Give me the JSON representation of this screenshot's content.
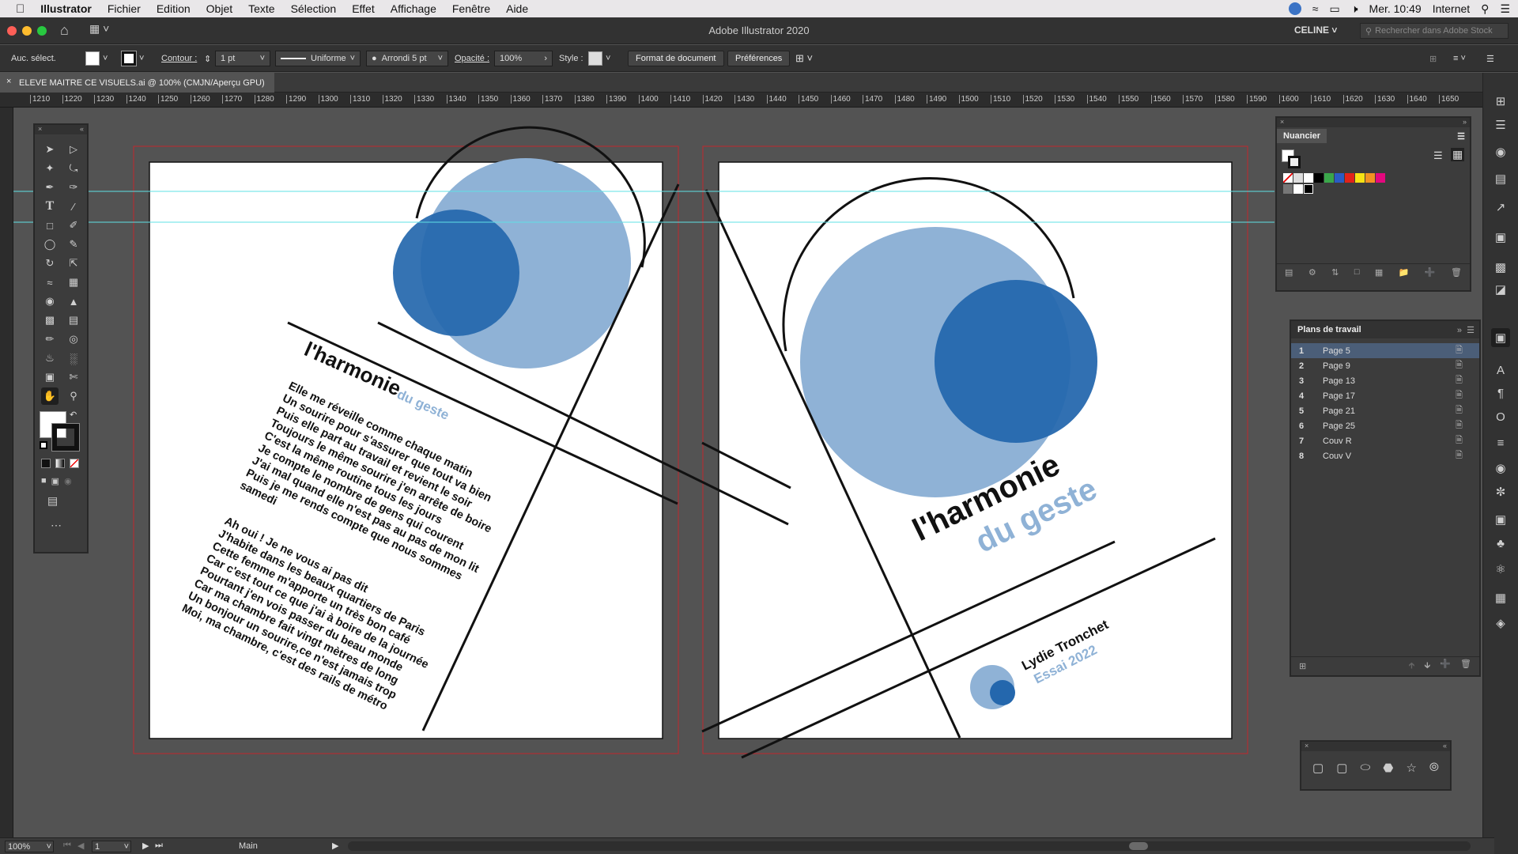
{
  "menubar": {
    "app": "Illustrator",
    "items": [
      "Fichier",
      "Edition",
      "Objet",
      "Texte",
      "Sélection",
      "Effet",
      "Affichage",
      "Fenêtre",
      "Aide"
    ],
    "clock": "Mer. 10:49",
    "network": "Internet"
  },
  "window": {
    "title": "Adobe Illustrator 2020",
    "user": "CELINE",
    "stock_search_placeholder": "Rechercher dans Adobe Stock"
  },
  "control": {
    "selection": "Auc. sélect.",
    "contour_label": "Contour :",
    "contour_value": "1 pt",
    "stroke_profile": "Uniforme",
    "brush": "Arrondi 5 pt",
    "opacity_label": "Opacité :",
    "opacity_value": "100%",
    "style_label": "Style :",
    "doc_format_button": "Format de document",
    "prefs_button": "Préférences"
  },
  "document_tab": "ELEVE MAITRE CE VISUELS.ai @ 100% (CMJN/Aperçu GPU)",
  "ruler_ticks": [
    "1210",
    "1220",
    "1230",
    "1240",
    "1250",
    "1260",
    "1270",
    "1280",
    "1290",
    "1300",
    "1310",
    "1320",
    "1330",
    "1340",
    "1350",
    "1360",
    "1370",
    "1380",
    "1390",
    "1400",
    "1410",
    "1420",
    "1430",
    "1440",
    "1450",
    "1460",
    "1470",
    "1480",
    "1490",
    "1500",
    "1510",
    "1520",
    "1530",
    "1540",
    "1550",
    "1560",
    "1570",
    "1580",
    "1590",
    "1600",
    "1610",
    "1620",
    "1630",
    "1640",
    "1650"
  ],
  "status": {
    "zoom": "100%",
    "artboard": "1",
    "tool": "Main"
  },
  "left_page": {
    "title_main": "l'harmonie",
    "title_sub": "du geste",
    "poem1": [
      "Elle me réveille comme chaque matin",
      "Un sourire pour s'assurer que tout va bien",
      "Puis elle part au travail et revient le soir",
      "Toujours le même sourire j'en arrête de boire",
      "C'est la même routine tous les jours",
      "Je compte le nombre de gens qui courent",
      "J'ai mal quand elle n'est pas au pas de mon lit",
      "Puis je me rends compte que nous sommes",
      "samedi"
    ],
    "poem2": [
      "Ah oui ! Je ne vous ai pas dit",
      "J'habite dans les beaux quartiers de Paris",
      "Cette femme m'apporte un très bon café",
      "Car c'est tout ce que j'ai à boire de la journée",
      "Pourtant j'en vois passer du beau monde",
      "Car ma chambre fait vingt mètres de long",
      "Un bonjour un sourire,ce n'est jamais trop",
      "Moi, ma chambre, c'est des rails de métro"
    ]
  },
  "right_page": {
    "title_main": "l'harmonie",
    "title_sub": "du geste",
    "author": "Lydie Tronchet",
    "subtitle": "Essai 2022"
  },
  "swatches_panel": {
    "title": "Nuancier"
  },
  "artboards_panel": {
    "title": "Plans de travail",
    "rows": [
      {
        "num": "1",
        "name": "Page 5"
      },
      {
        "num": "2",
        "name": "Page 9"
      },
      {
        "num": "3",
        "name": "Page 13"
      },
      {
        "num": "4",
        "name": "Page 17"
      },
      {
        "num": "5",
        "name": "Page 21"
      },
      {
        "num": "6",
        "name": "Page 25"
      },
      {
        "num": "7",
        "name": "Couv R"
      },
      {
        "num": "8",
        "name": "Couv V"
      }
    ]
  },
  "colors": {
    "light_blue": "#8fb2d6",
    "dark_blue": "#2467ad",
    "bleed_red": "#c0272d",
    "guide_cyan": "#5fe0e6",
    "selected_row": "#4b5e78"
  }
}
